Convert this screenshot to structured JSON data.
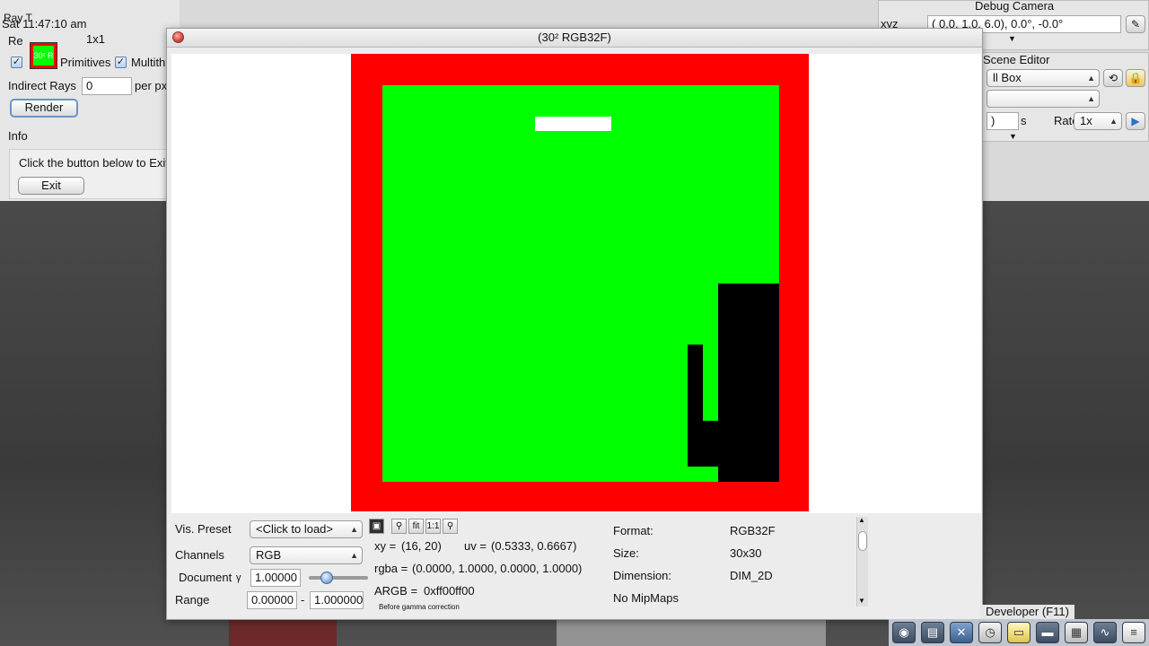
{
  "left_panel": {
    "title_partial": "Ray T",
    "clock": "Sat 11:47:10 am",
    "resolution_label_partial": "Re",
    "resolution_value": "1x1",
    "thumbnail_text": "30² R",
    "primitives_label": "Primitives",
    "multithreaded_label": "Multith",
    "indirect_rays_label": "Indirect Rays",
    "indirect_rays_value": "0",
    "per_px_label": "per px",
    "render_button": "Render",
    "info_label": "Info",
    "info_text": "Click the button below to Exit",
    "exit_button": "Exit"
  },
  "debug_camera": {
    "title": "Debug Camera",
    "xyz_label": "xyz",
    "value": "(  0.0,   1.0,   6.0),   0.0°,  -0.0°"
  },
  "scene_editor": {
    "title": "Scene Editor",
    "scene_value": "ll Box",
    "speed_partial": ")",
    "seconds_unit": "s",
    "rate_label": "Rate",
    "rate_value": "1x"
  },
  "viewer": {
    "title": "(30² RGB32F)",
    "vis_preset_label": "Vis. Preset",
    "vis_preset_value": "<Click to load>",
    "channels_label": "Channels",
    "channels_value": "RGB",
    "document_label": "Document",
    "gamma_symbol": "γ",
    "gamma_value": "1.00000",
    "gamma_fraction": 0.25,
    "range_label": "Range",
    "range_min": "0.00000",
    "range_dash": "-",
    "range_max": "1.000000",
    "tools": {
      "fit": "fit",
      "one_to_one": "1:1"
    },
    "xy_label": "xy =",
    "xy_value": "(16, 20)",
    "uv_label": "uv =",
    "uv_value": "(0.5333, 0.6667)",
    "rgba_label": "rgba =",
    "rgba_value": "(0.0000, 1.0000, 0.0000, 1.0000)",
    "argb_label": "ARGB =",
    "argb_value": "0xff00ff00",
    "gamma_note": "Before gamma correction",
    "format_label": "Format:",
    "format_value": "RGB32F",
    "size_label": "Size:",
    "size_value": "30x30",
    "dimension_label": "Dimension:",
    "dimension_value": "DIM_2D",
    "mipmaps_text": "No MipMaps"
  },
  "dock": {
    "developer_label": "Developer (F11)"
  },
  "colors": {
    "texture_border": "#ff0000",
    "texture_fill": "#00ff00",
    "texture_shapes": "#000000"
  }
}
